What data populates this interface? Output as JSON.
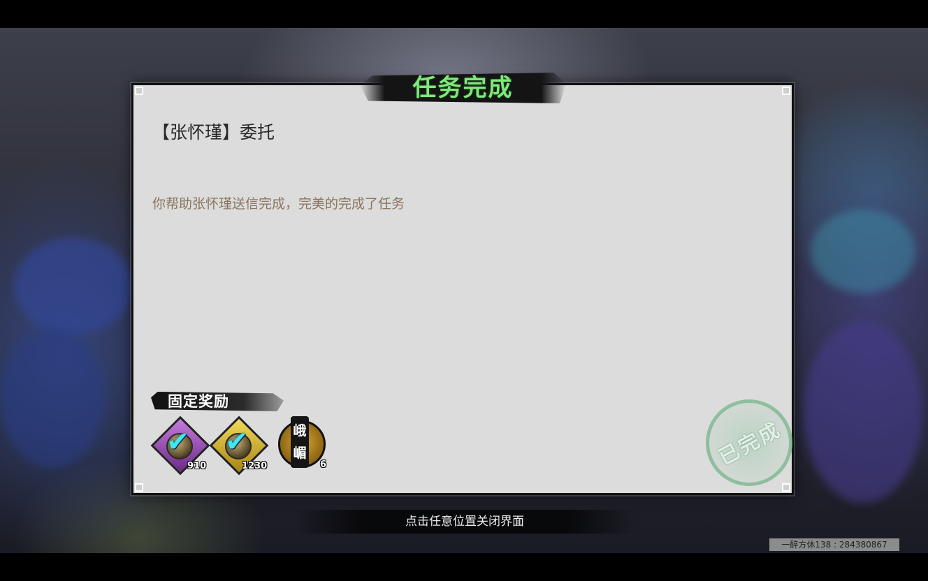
{
  "dialog": {
    "title": "任务完成",
    "quest_name": "【张怀瑾】委托",
    "description": "你帮助张怀瑾送信完成，完美的完成了任务",
    "stamp_text": "已完成"
  },
  "rewards": {
    "title": "固定奖励",
    "items": [
      {
        "icon": "purple-diamond-coin-icon",
        "count": "910",
        "color": "#8a3fa0"
      },
      {
        "icon": "gold-diamond-coin-icon",
        "count": "1230",
        "color": "#c9ad2a"
      },
      {
        "icon": "emei-sect-token-icon",
        "count": "6",
        "glyph_top": "峨",
        "glyph_bottom": "嵋"
      }
    ]
  },
  "footer": {
    "close_hint": "点击任意位置关闭界面",
    "watermark": "一醉方休138 : 284380867"
  },
  "colors": {
    "title_green": "#7ee87a",
    "check_cyan": "#3fe6ef",
    "stamp_green": "#78b48c"
  }
}
